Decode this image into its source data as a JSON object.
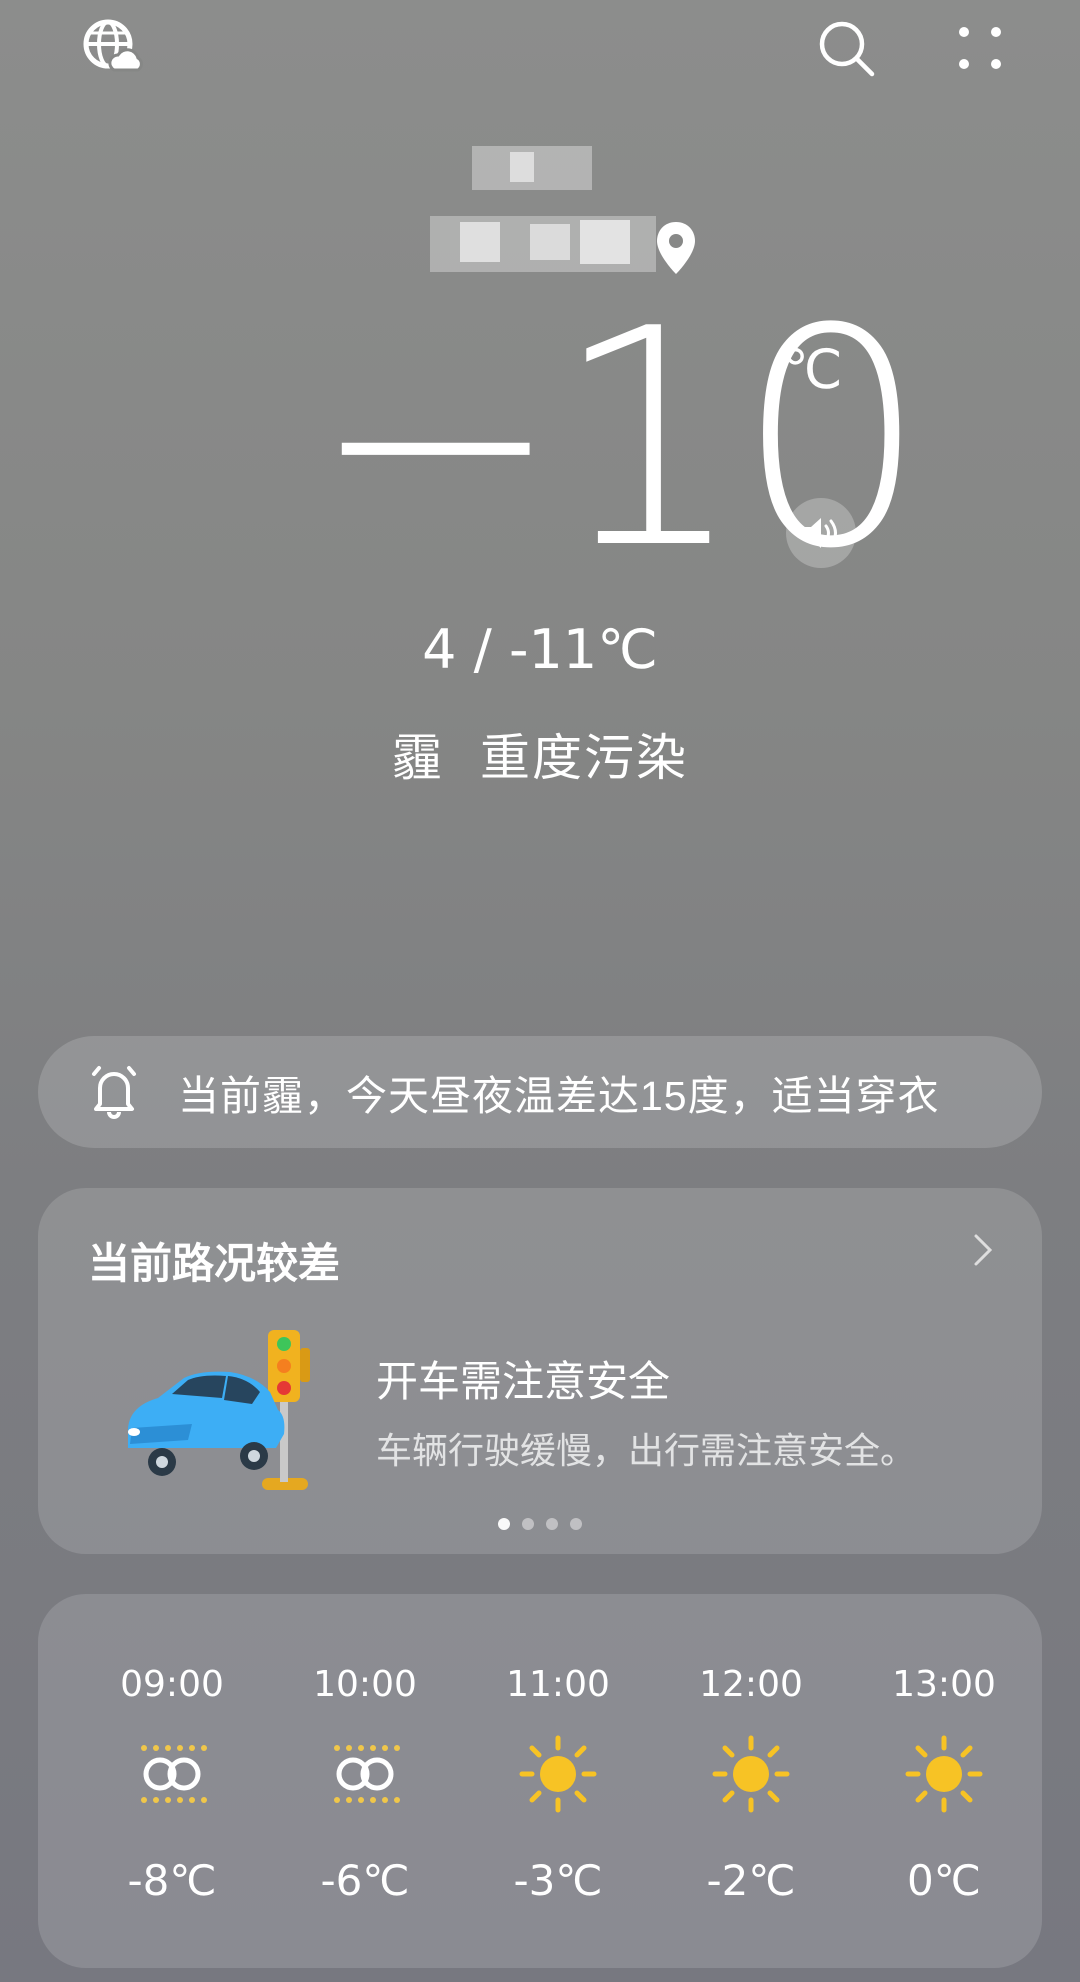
{
  "current": {
    "temperature": "−10",
    "unit": "℃",
    "range": "4 / -11℃",
    "condition": "霾",
    "air_quality": "重度污染"
  },
  "alert": {
    "text": "当前霾，今天昼夜温差达15度，适当穿衣"
  },
  "road_card": {
    "title": "当前路况较差",
    "tip_title": "开车需注意安全",
    "tip_desc": "车辆行驶缓慢，出行需注意安全。",
    "page_count": 4,
    "active_page": 1
  },
  "hourly": [
    {
      "time": "09:00",
      "icon": "haze-icon",
      "temp": "-8℃"
    },
    {
      "time": "10:00",
      "icon": "haze-icon",
      "temp": "-6℃"
    },
    {
      "time": "11:00",
      "icon": "sun-icon",
      "temp": "-3℃"
    },
    {
      "time": "12:00",
      "icon": "sun-icon",
      "temp": "-2℃"
    },
    {
      "time": "13:00",
      "icon": "sun-icon",
      "temp": "0℃"
    }
  ],
  "colors": {
    "sun": "#f7c325",
    "haze": "#f0c74a"
  }
}
